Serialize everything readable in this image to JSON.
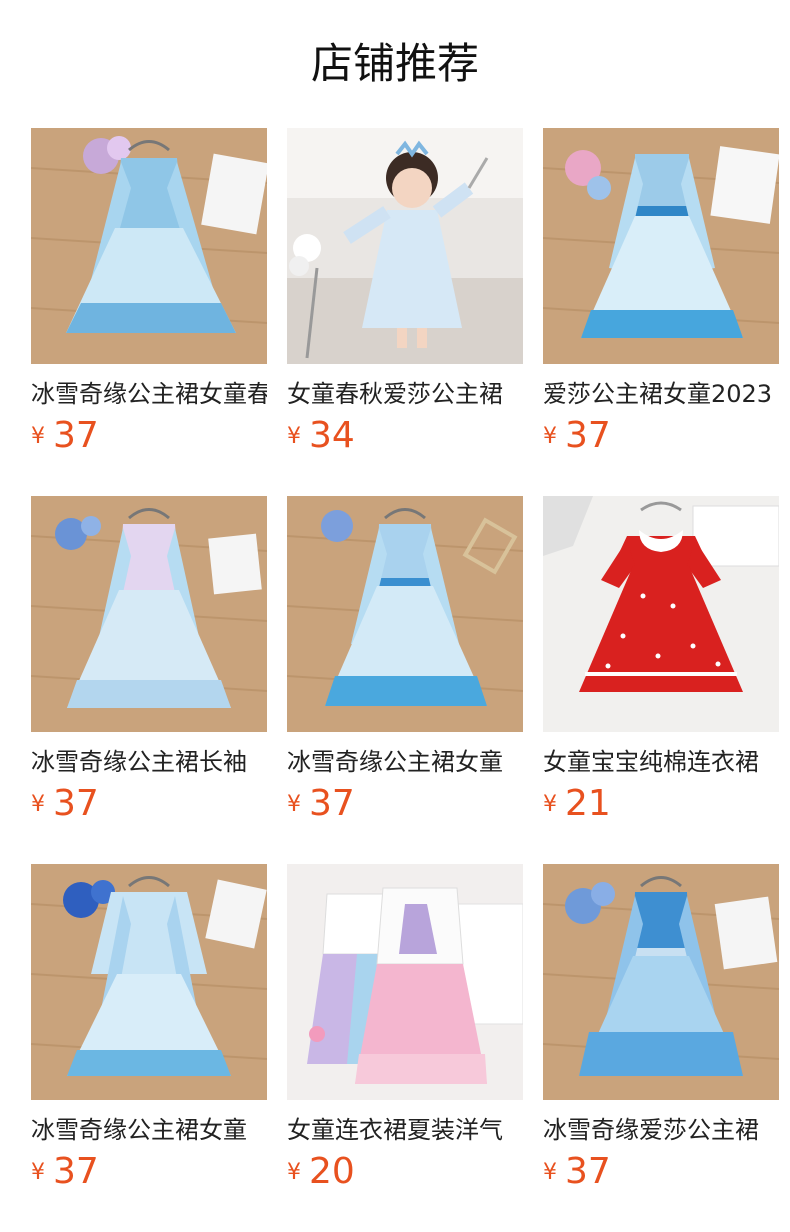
{
  "header": {
    "title": "店铺推荐"
  },
  "products": [
    {
      "name": "冰雪奇缘公主裙女童春秋",
      "currency": "¥",
      "price": "37",
      "image": "blue-dress-photo"
    },
    {
      "name": "女童春秋爱莎公主裙",
      "currency": "¥",
      "price": "34",
      "image": "girl-in-dress-photo"
    },
    {
      "name": "爱莎公主裙女童2023",
      "currency": "¥",
      "price": "37",
      "image": "blue-dress-photo"
    },
    {
      "name": "冰雪奇缘公主裙长袖",
      "currency": "¥",
      "price": "37",
      "image": "blue-dress-photo"
    },
    {
      "name": "冰雪奇缘公主裙女童",
      "currency": "¥",
      "price": "37",
      "image": "blue-dress-photo"
    },
    {
      "name": "女童宝宝纯棉连衣裙",
      "currency": "¥",
      "price": "21",
      "image": "red-polka-dress-photo"
    },
    {
      "name": "冰雪奇缘公主裙女童",
      "currency": "¥",
      "price": "37",
      "image": "blue-dress-photo"
    },
    {
      "name": "女童连衣裙夏装洋气",
      "currency": "¥",
      "price": "20",
      "image": "pink-tulle-dress-photo"
    },
    {
      "name": "冰雪奇缘爱莎公主裙",
      "currency": "¥",
      "price": "37",
      "image": "blue-dress-photo"
    }
  ],
  "colors": {
    "price": "#e8511f",
    "wood": "#c9a37c",
    "dress_blue": "#9ccbe9",
    "dress_red": "#d9211f",
    "dress_pink": "#f4b6cf"
  }
}
